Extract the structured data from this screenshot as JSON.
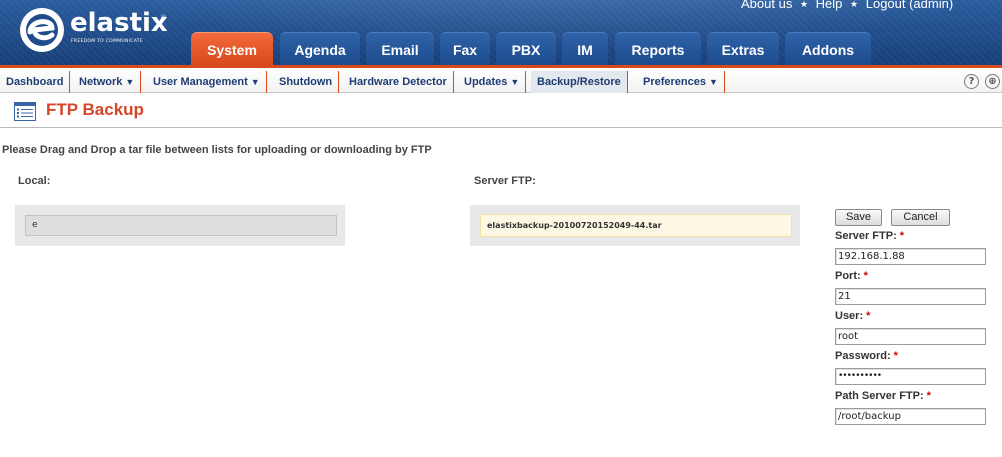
{
  "brand": {
    "name": "elastix",
    "registered": "®",
    "tagline": "FREEDOM TO COMMUNICATE"
  },
  "top_links": {
    "about": "About us",
    "help": "Help",
    "logout": "Logout (admin)",
    "separator": "★"
  },
  "main_tabs": [
    {
      "label": "System",
      "active": true
    },
    {
      "label": "Agenda"
    },
    {
      "label": "Email"
    },
    {
      "label": "Fax"
    },
    {
      "label": "PBX"
    },
    {
      "label": "IM"
    },
    {
      "label": "Reports"
    },
    {
      "label": "Extras"
    },
    {
      "label": "Addons"
    }
  ],
  "sub_nav": [
    {
      "label": "Dashboard",
      "arrow": ""
    },
    {
      "label": "Network",
      "arrow": "▼"
    },
    {
      "label": "User Management",
      "arrow": "▼"
    },
    {
      "label": "Shutdown",
      "arrow": ""
    },
    {
      "label": "Hardware Detector",
      "arrow": ""
    },
    {
      "label": "Updates",
      "arrow": "▼"
    },
    {
      "label": "Backup/Restore",
      "arrow": "",
      "active": true
    },
    {
      "label": "Preferences",
      "arrow": "▼"
    }
  ],
  "nav_buttons": {
    "help_icon": "?",
    "plus_icon": "⊕"
  },
  "page": {
    "title": "FTP Backup",
    "title_icon": "list-document-icon",
    "instructions": "Please Drag and Drop a tar file between lists for uploading or downloading by FTP",
    "local_label": "Local:",
    "server_label": "Server FTP:",
    "local_items": [
      "e"
    ],
    "server_items": [
      "elastixbackup-20100720152049-44.tar"
    ]
  },
  "form": {
    "save_label": "Save",
    "cancel_label": "Cancel",
    "required_mark": "*",
    "fields": {
      "server": {
        "label": "Server FTP:",
        "value": "192.168.1.88"
      },
      "port": {
        "label": "Port:",
        "value": "21"
      },
      "user": {
        "label": "User:",
        "value": "root"
      },
      "password": {
        "label": "Password:",
        "value": "••••••••••"
      },
      "path": {
        "label": "Path Server FTP:",
        "value": "/root/backup"
      }
    }
  },
  "colors": {
    "header_blue": "#1f4d8c",
    "active_tab": "#e0542a",
    "title_red": "#d6472a",
    "required": "#d60000"
  }
}
